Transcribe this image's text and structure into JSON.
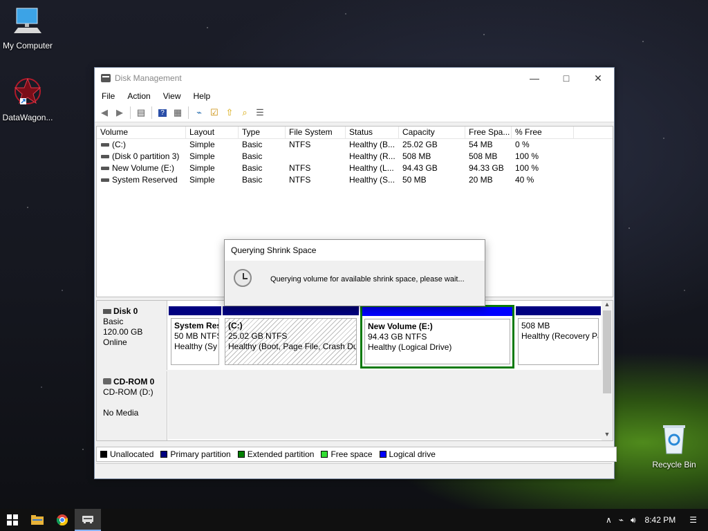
{
  "desktop": {
    "icons": [
      {
        "label": "My Computer"
      },
      {
        "label": "DataWagon..."
      },
      {
        "label": "Recycle Bin"
      }
    ]
  },
  "window": {
    "title": "Disk Management",
    "menu": [
      "File",
      "Action",
      "View",
      "Help"
    ],
    "toolbar_icons": [
      "back-arrow-icon",
      "forward-arrow-icon",
      "list-icon",
      "help-icon",
      "properties-icon",
      "connect-icon",
      "check-icon",
      "upload-icon",
      "search-folder-icon",
      "settings-icon"
    ],
    "columns": [
      "Volume",
      "Layout",
      "Type",
      "File System",
      "Status",
      "Capacity",
      "Free Spa...",
      "% Free"
    ],
    "rows": [
      {
        "volume": "(C:)",
        "layout": "Simple",
        "type": "Basic",
        "fs": "NTFS",
        "status": "Healthy (B...",
        "capacity": "25.02 GB",
        "free": "54 MB",
        "pct": "0 %"
      },
      {
        "volume": "(Disk 0 partition 3)",
        "layout": "Simple",
        "type": "Basic",
        "fs": "",
        "status": "Healthy (R...",
        "capacity": "508 MB",
        "free": "508 MB",
        "pct": "100 %"
      },
      {
        "volume": "New Volume (E:)",
        "layout": "Simple",
        "type": "Basic",
        "fs": "NTFS",
        "status": "Healthy (L...",
        "capacity": "94.43 GB",
        "free": "94.33 GB",
        "pct": "100 %"
      },
      {
        "volume": "System Reserved",
        "layout": "Simple",
        "type": "Basic",
        "fs": "NTFS",
        "status": "Healthy (S...",
        "capacity": "50 MB",
        "free": "20 MB",
        "pct": "40 %"
      }
    ],
    "disk0": {
      "name": "Disk 0",
      "type": "Basic",
      "size": "120.00 GB",
      "state": "Online",
      "partitions": [
        {
          "title": "System Res",
          "line2": "50 MB NTFS",
          "line3": "Healthy (Sy"
        },
        {
          "title": "(C:)",
          "line2": "25.02 GB NTFS",
          "line3": "Healthy (Boot, Page File, Crash Dur"
        },
        {
          "title": "New Volume  (E:)",
          "line2": "94.43 GB NTFS",
          "line3": "Healthy (Logical Drive)"
        },
        {
          "title": "",
          "line2": "508 MB",
          "line3": "Healthy (Recovery Pa"
        }
      ]
    },
    "cdrom": {
      "name": "CD-ROM 0",
      "drive": "CD-ROM (D:)",
      "media": "No Media"
    },
    "legend": [
      {
        "label": "Unallocated",
        "color": "#000000"
      },
      {
        "label": "Primary partition",
        "color": "#000080"
      },
      {
        "label": "Extended partition",
        "color": "#008000"
      },
      {
        "label": "Free space",
        "color": "#33dd33"
      },
      {
        "label": "Logical drive",
        "color": "#0000ff"
      }
    ]
  },
  "dialog": {
    "title": "Querying Shrink Space",
    "message": "Querying volume for available shrink space, please wait..."
  },
  "taskbar": {
    "time": "8:42 PM"
  }
}
